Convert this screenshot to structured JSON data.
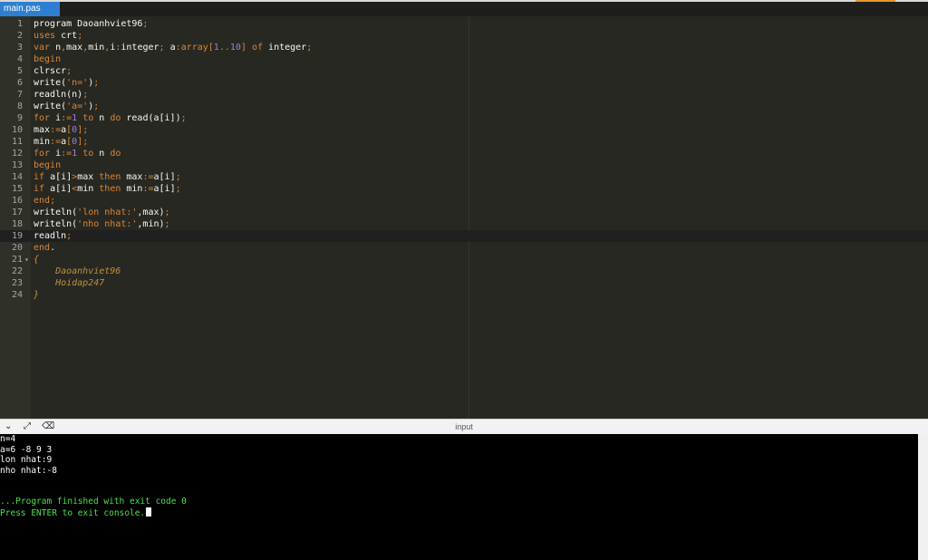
{
  "tab": {
    "label": "main.pas"
  },
  "accent_colors": [
    "#e8962e",
    "#d9d9d9"
  ],
  "code_lines": [
    {
      "n": "1",
      "html": "program Daoanhviet96<span class=\"op\">;</span>"
    },
    {
      "n": "2",
      "html": "<span class=\"kw\">uses</span> crt<span class=\"op\">;</span>"
    },
    {
      "n": "3",
      "html": "<span class=\"kw\">var</span> n<span class=\"op\">,</span>max<span class=\"op\">,</span>min<span class=\"op\">,</span>i<span class=\"op\">:</span>integer<span class=\"op\">;</span> a<span class=\"op\">:</span><span class=\"kw\">array</span><span class=\"op\">[</span><span class=\"num\">1</span><span class=\"op\">..</span><span class=\"num\">10</span><span class=\"op\">]</span> <span class=\"kw\">of</span> integer<span class=\"op\">;</span>"
    },
    {
      "n": "4",
      "html": "<span class=\"kw\">begin</span>"
    },
    {
      "n": "5",
      "html": "clrscr<span class=\"op\">;</span>"
    },
    {
      "n": "6",
      "html": "write(<span class=\"str\">'n='</span>)<span class=\"op\">;</span>"
    },
    {
      "n": "7",
      "html": "readln(n)<span class=\"op\">;</span>"
    },
    {
      "n": "8",
      "html": "write(<span class=\"str\">'a='</span>)<span class=\"op\">;</span>"
    },
    {
      "n": "9",
      "html": "<span class=\"kw\">for</span> i<span class=\"op\">:=</span><span class=\"num\">1</span> <span class=\"kw\">to</span> n <span class=\"kw\">do</span> read(a[i])<span class=\"op\">;</span>"
    },
    {
      "n": "10",
      "html": "max<span class=\"op\">:=</span>a<span class=\"op\">[</span><span class=\"num\">0</span><span class=\"op\">]</span><span class=\"op\">;</span>"
    },
    {
      "n": "11",
      "html": "min<span class=\"op\">:=</span>a<span class=\"op\">[</span><span class=\"num\">0</span><span class=\"op\">]</span><span class=\"op\">;</span>"
    },
    {
      "n": "12",
      "html": "<span class=\"kw\">for</span> i<span class=\"op\">:=</span><span class=\"num\">1</span> <span class=\"kw\">to</span> n <span class=\"kw\">do</span>"
    },
    {
      "n": "13",
      "html": "<span class=\"kw\">begin</span>"
    },
    {
      "n": "14",
      "html": "<span class=\"kw\">if</span> a[i]<span class=\"op\">&gt;</span>max <span class=\"kw\">then</span> max<span class=\"op\">:=</span>a[i]<span class=\"op\">;</span>"
    },
    {
      "n": "15",
      "html": "<span class=\"kw\">if</span> a[i]<span class=\"op\">&lt;</span>min <span class=\"kw\">then</span> min<span class=\"op\">:=</span>a[i]<span class=\"op\">;</span>"
    },
    {
      "n": "16",
      "html": "<span class=\"kw\">end</span><span class=\"op\">;</span>"
    },
    {
      "n": "17",
      "html": "writeln(<span class=\"str\">'lon nhat:'</span>,max)<span class=\"op\">;</span>"
    },
    {
      "n": "18",
      "html": "writeln(<span class=\"str\">'nho nhat:'</span>,min)<span class=\"op\">;</span>"
    },
    {
      "n": "19",
      "html": "readln<span class=\"op\">;</span>",
      "active": true
    },
    {
      "n": "20",
      "html": "<span class=\"kw\">end</span>."
    },
    {
      "n": "21",
      "html": "<span class=\"cm\">{</span>",
      "fold": true
    },
    {
      "n": "22",
      "html": "<span class=\"cm\">    Daoanhviet96</span>"
    },
    {
      "n": "23",
      "html": "<span class=\"cm\">    Hoidap247</span>"
    },
    {
      "n": "24",
      "html": "<span class=\"cm\">}</span>"
    }
  ],
  "panel": {
    "title": "input"
  },
  "console_lines": [
    {
      "text": "n=4",
      "green": false
    },
    {
      "text": "a=6 -8 9 3",
      "green": false
    },
    {
      "text": "lon nhat:9",
      "green": false
    },
    {
      "text": "nho nhat:-8",
      "green": false
    },
    {
      "text": "",
      "green": false
    },
    {
      "text": "",
      "green": false
    },
    {
      "text": "...Program finished with exit code 0",
      "green": true
    },
    {
      "text": "Press ENTER to exit console.",
      "green": true,
      "cursor": true
    }
  ]
}
